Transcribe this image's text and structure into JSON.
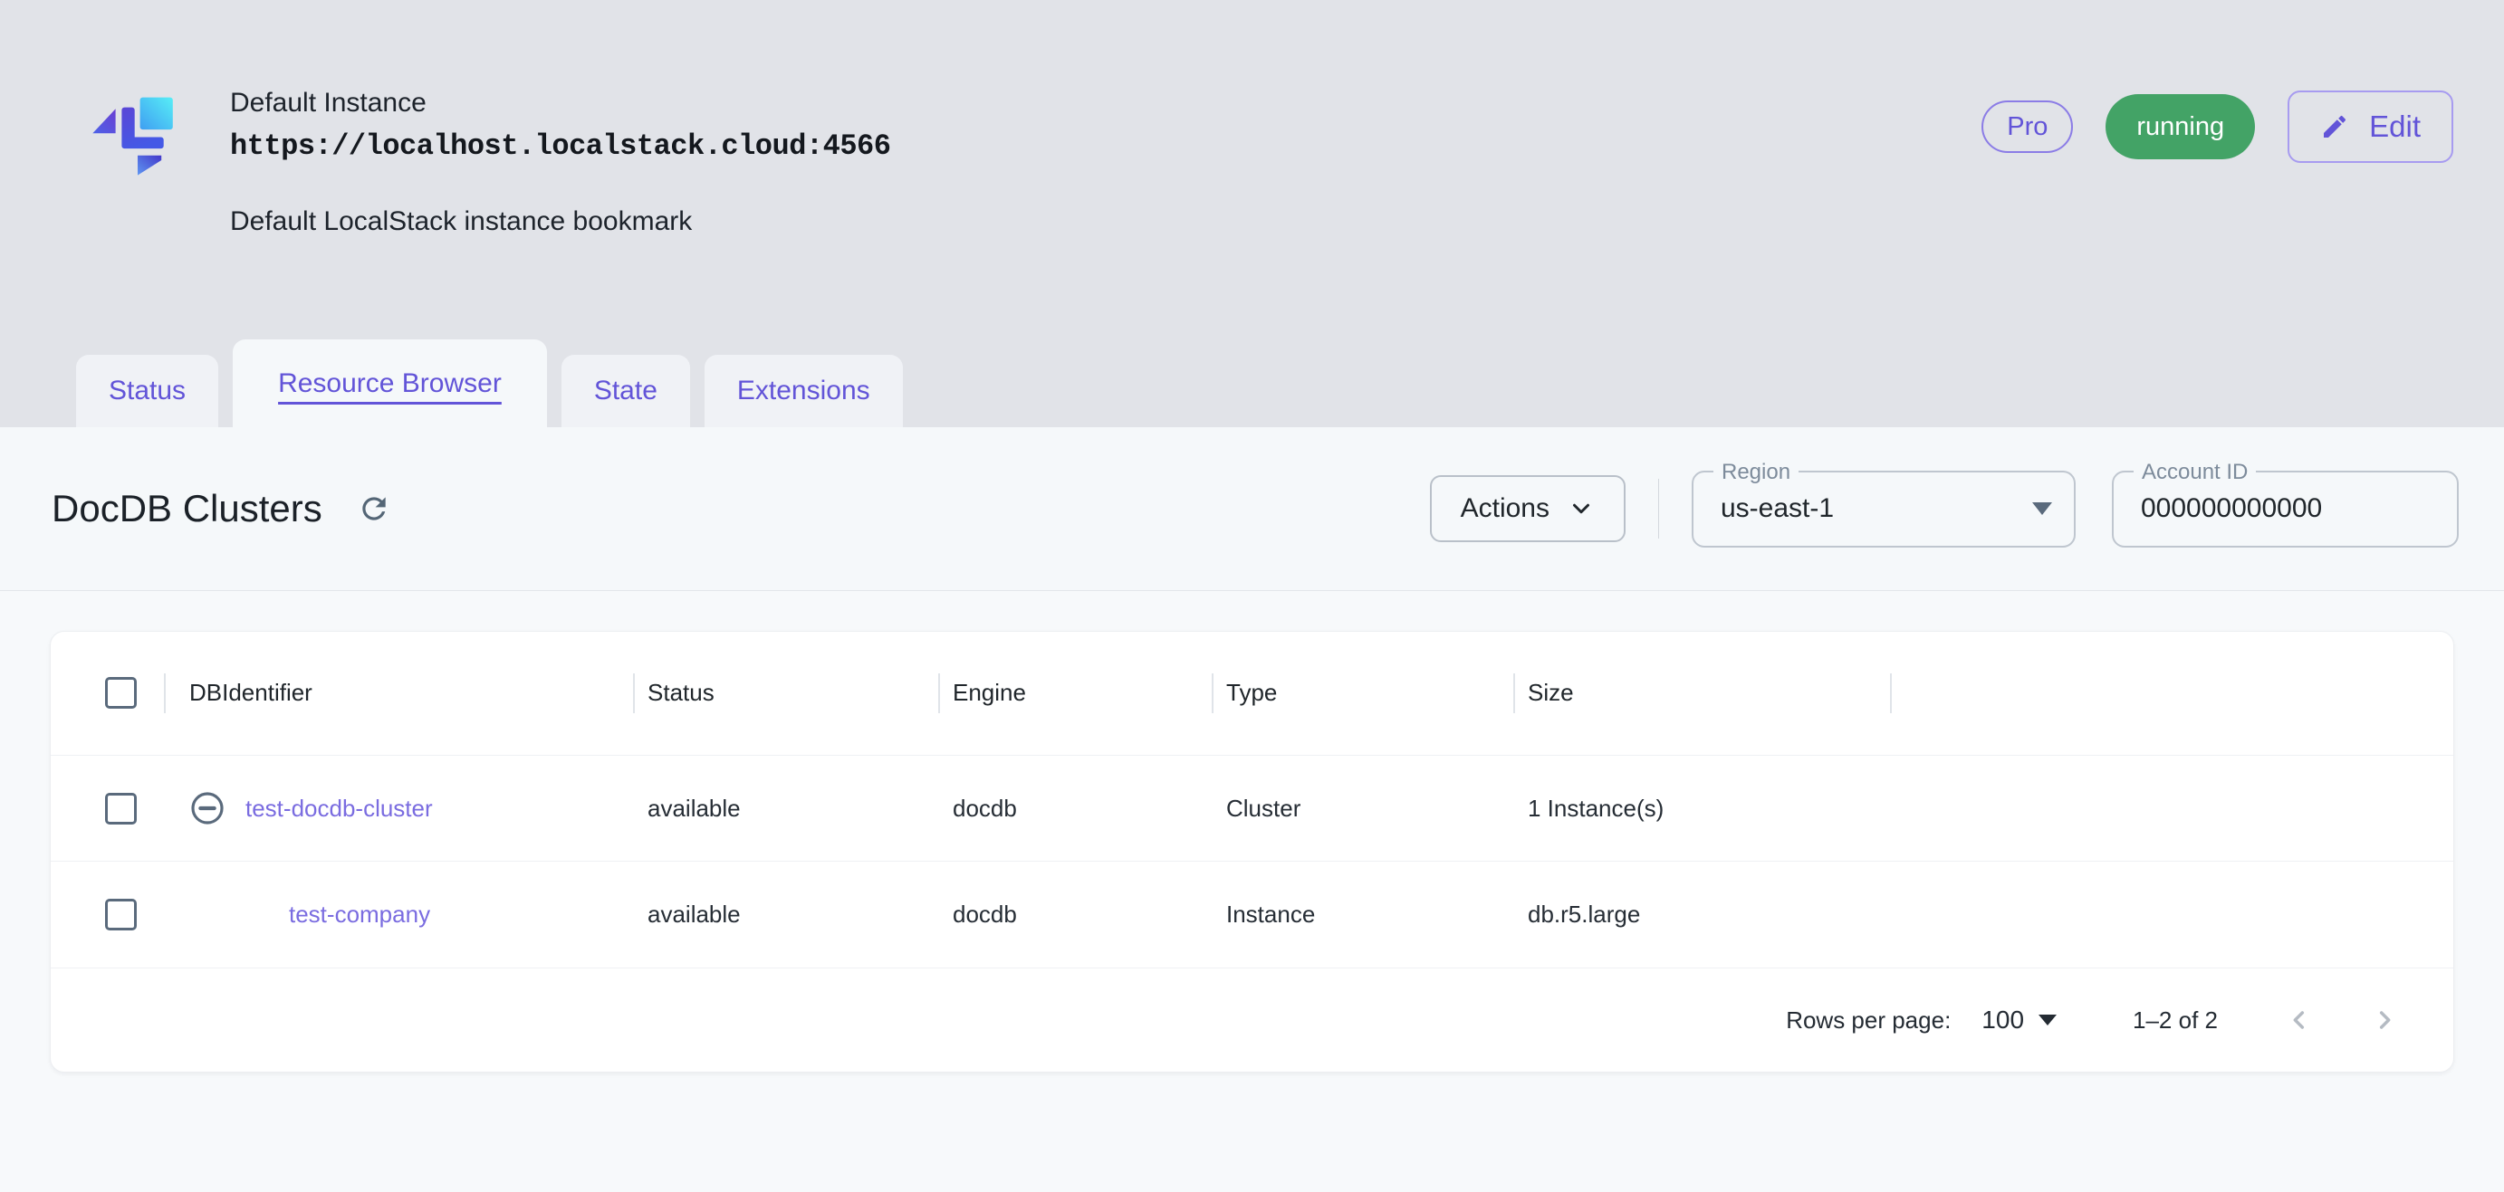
{
  "instance": {
    "name": "Default Instance",
    "url": "https://localhost.localstack.cloud:4566",
    "description": "Default LocalStack instance bookmark",
    "plan_badge": "Pro",
    "status_badge": "running",
    "edit_button": "Edit"
  },
  "tabs": [
    {
      "label": "Status",
      "active": false
    },
    {
      "label": "Resource Browser",
      "active": true
    },
    {
      "label": "State",
      "active": false
    },
    {
      "label": "Extensions",
      "active": false
    }
  ],
  "toolbar": {
    "heading": "DocDB Clusters",
    "actions_button": "Actions",
    "region": {
      "label": "Region",
      "value": "us-east-1"
    },
    "account": {
      "label": "Account ID",
      "value": "000000000000"
    }
  },
  "table": {
    "columns": {
      "id": "DBIdentifier",
      "status": "Status",
      "engine": "Engine",
      "type": "Type",
      "size": "Size"
    },
    "rows": [
      {
        "id": "test-docdb-cluster",
        "status": "available",
        "engine": "docdb",
        "type": "Cluster",
        "size": "1 Instance(s)",
        "expander": "minus-circle-icon",
        "indent": false
      },
      {
        "id": "test-company",
        "status": "available",
        "engine": "docdb",
        "type": "Instance",
        "size": "db.r5.large",
        "expander": null,
        "indent": true
      }
    ],
    "pagination": {
      "rows_per_page_label": "Rows per page:",
      "rows_per_page_value": "100",
      "range_label": "1–2 of 2"
    }
  },
  "colors": {
    "accent_purple": "#6254d8",
    "link_purple": "#7a6ce0",
    "success_green": "#43a366",
    "slate_icon": "#5a6a7c",
    "hero_background": "#e1e3e8",
    "toolbar_background": "#f5f8fa"
  },
  "icons": {
    "logo": "localstack-logo",
    "edit": "pencil-icon",
    "refresh": "refresh-icon",
    "actions": "chevron-down-icon",
    "region_select": "arrow-drop-down-icon",
    "row_expander": "minus-circle-icon",
    "rows_per_page": "arrow-drop-down-icon",
    "prev_page": "chevron-left-icon",
    "next_page": "chevron-right-icon"
  }
}
